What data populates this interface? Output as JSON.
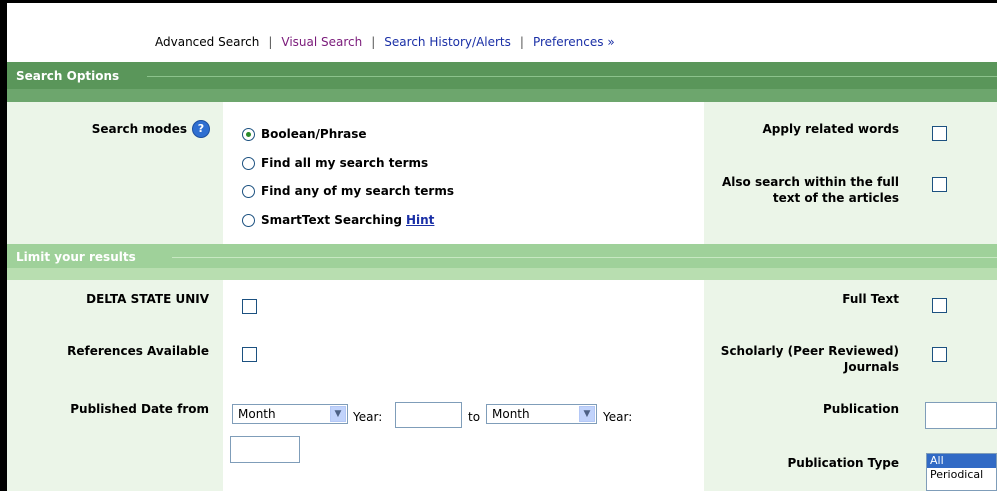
{
  "nav": {
    "advanced_search": "Advanced Search",
    "visual_search": "Visual Search",
    "search_history": "Search History/Alerts",
    "preferences": "Preferences »",
    "separator": "|"
  },
  "search_options": {
    "title": "Search Options",
    "search_modes_label": "Search modes",
    "modes": [
      {
        "label": "Boolean/Phrase",
        "checked": true
      },
      {
        "label": "Find all my search terms",
        "checked": false
      },
      {
        "label": "Find any of my search terms",
        "checked": false
      },
      {
        "label": "SmartText Searching",
        "checked": false
      }
    ],
    "hint_link": "Hint",
    "apply_related_words": "Apply related words",
    "also_search_fulltext": "Also search within the full text of the articles"
  },
  "limits": {
    "title": "Limit your results",
    "delta_state": "DELTA STATE UNIV",
    "references_available": "References Available",
    "published_date_from": "Published Date from",
    "month_select": "Month",
    "year_label": "Year:",
    "to_label": "to",
    "full_text": "Full Text",
    "scholarly": "Scholarly (Peer Reviewed) Journals",
    "publication": "Publication",
    "publication_type": "Publication Type",
    "publication_type_options": [
      "All",
      "Periodical"
    ]
  },
  "colors": {
    "section_bar_dark": "#5a965a",
    "section_bar_light": "#9fd19a",
    "label_bg": "#ebf5e8",
    "link": "#1a2fa6",
    "visited_link": "#7a1a7a"
  }
}
